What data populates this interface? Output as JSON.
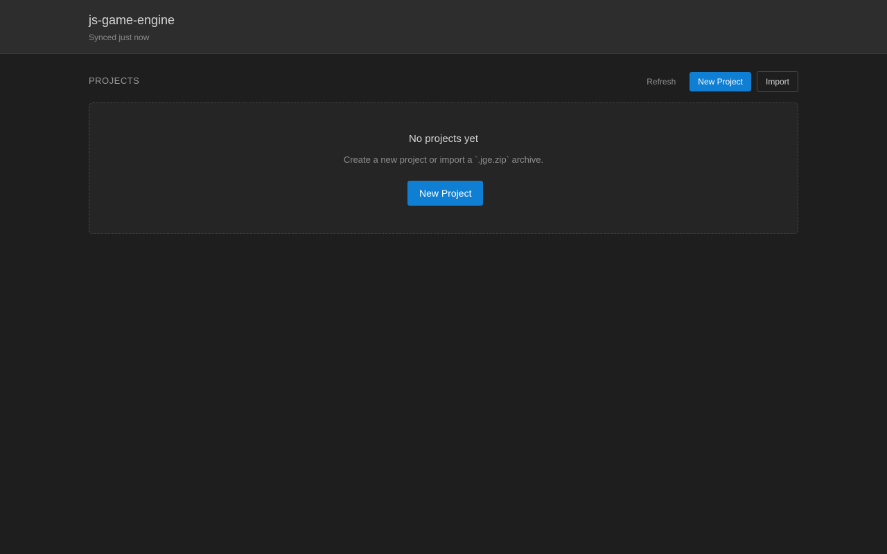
{
  "header": {
    "title": "js-game-engine",
    "sync_status": "Synced just now"
  },
  "projects": {
    "section_title": "PROJECTS",
    "actions": {
      "refresh_label": "Refresh",
      "new_project_label": "New Project",
      "import_label": "Import"
    },
    "empty_state": {
      "title": "No projects yet",
      "description": "Create a new project or import a `.jge.zip` archive.",
      "cta_label": "New Project"
    }
  },
  "colors": {
    "background": "#1e1e1e",
    "header_background": "#2d2d2d",
    "card_background": "#252525",
    "accent": "#0e7fd3"
  }
}
